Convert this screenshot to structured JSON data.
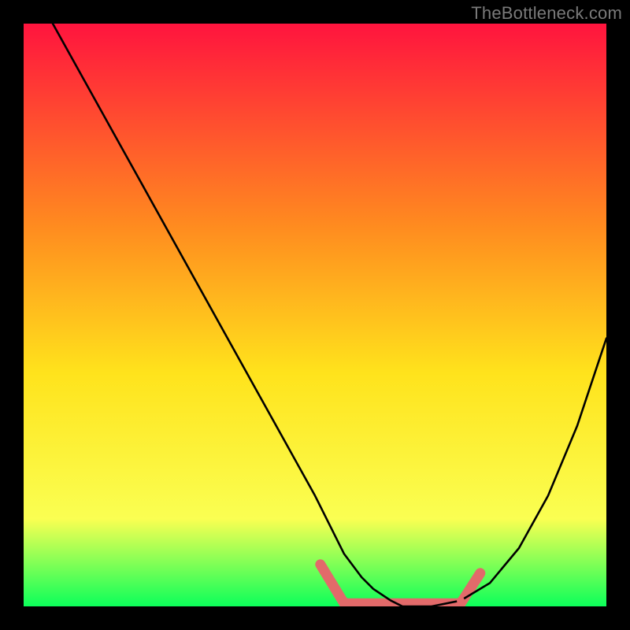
{
  "watermark": "TheBottleneck.com",
  "colors": {
    "background": "#000000",
    "gradient_top": "#ff143e",
    "gradient_mid1": "#ff8c1f",
    "gradient_mid2": "#ffe31c",
    "gradient_mid3": "#faff52",
    "gradient_bottom": "#0cff5a",
    "curve": "#000000",
    "marker": "#e26a6a"
  },
  "chart_data": {
    "type": "line",
    "title": "",
    "xlabel": "",
    "ylabel": "",
    "xlim": [
      0,
      100
    ],
    "ylim": [
      0,
      100
    ],
    "grid": false,
    "annotations": [],
    "series": [
      {
        "name": "bottleneck-curve",
        "x": [
          5,
          10,
          15,
          20,
          25,
          30,
          35,
          40,
          45,
          50,
          53,
          55,
          58,
          60,
          63,
          65,
          68,
          70,
          75,
          80,
          85,
          90,
          95,
          100
        ],
        "y": [
          100,
          91,
          82,
          73,
          64,
          55,
          46,
          37,
          28,
          19,
          13,
          9,
          5,
          3,
          1,
          0,
          0,
          0,
          1,
          4,
          10,
          19,
          31,
          46
        ]
      }
    ],
    "markers": [
      {
        "name": "flat-zone-left-end",
        "x": 55,
        "y": 1
      },
      {
        "name": "flat-zone-right-end",
        "x": 75,
        "y": 1
      }
    ],
    "highlight_segment": {
      "name": "flat-bottom",
      "x_start": 55,
      "x_end": 75,
      "y": 0.5
    }
  }
}
